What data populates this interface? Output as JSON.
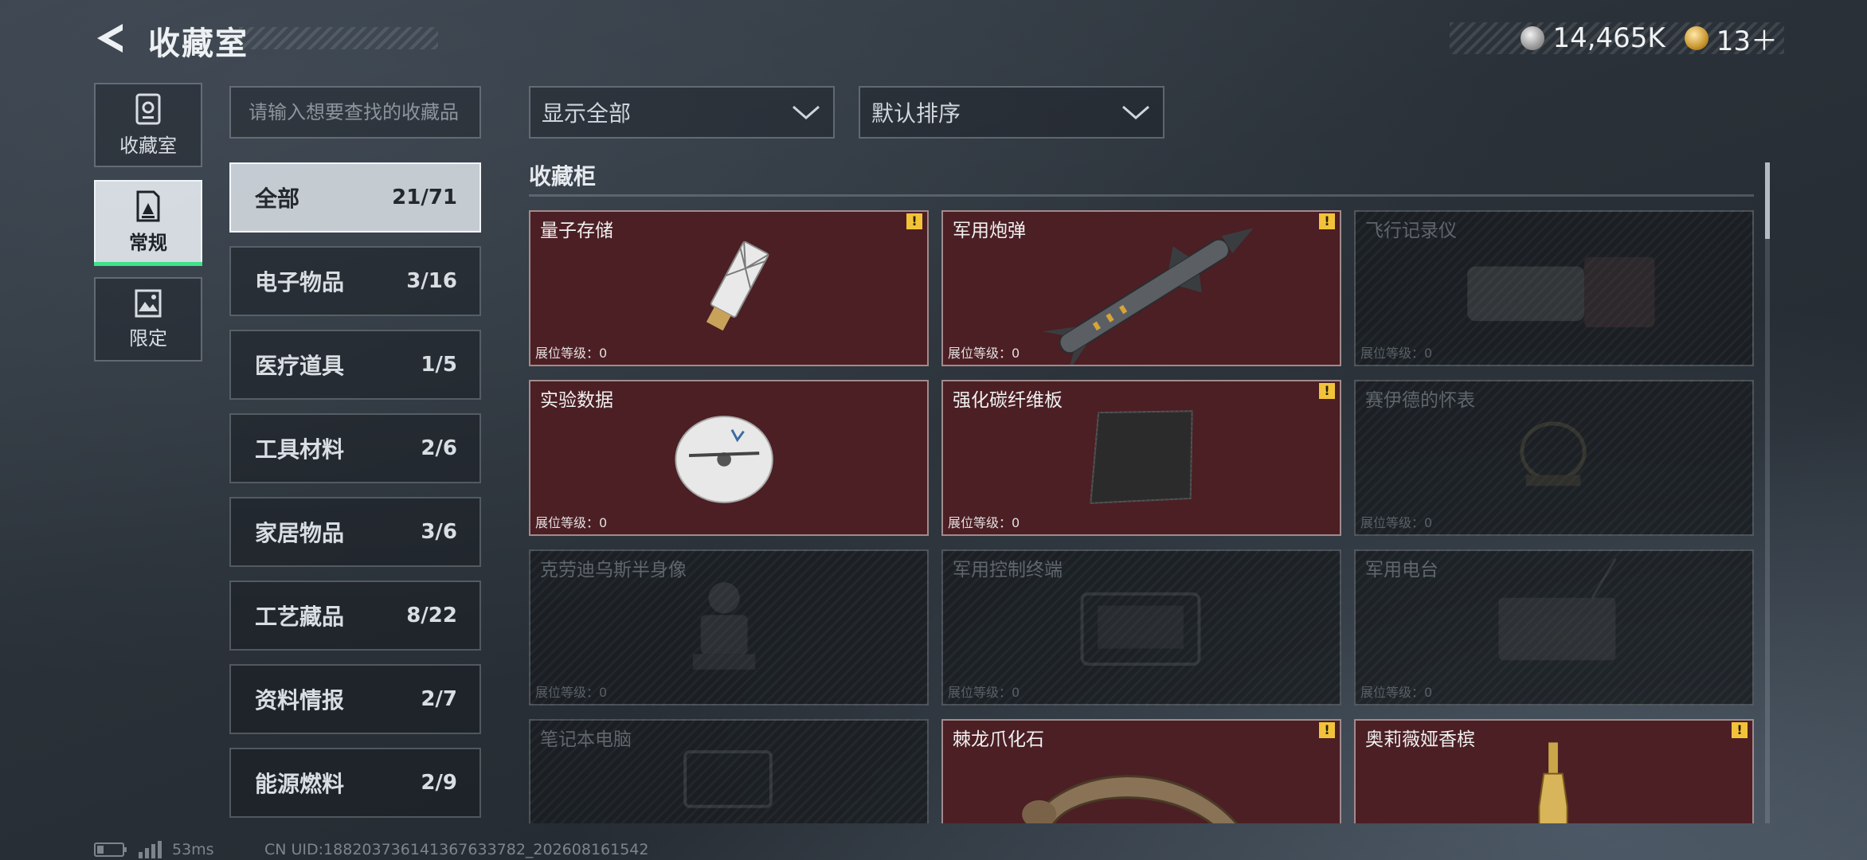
{
  "header": {
    "title": "收藏室",
    "currency": [
      {
        "icon": "silver-coin-icon",
        "value": "14,465K"
      },
      {
        "icon": "gold-coin-icon",
        "value": "13＋"
      }
    ]
  },
  "sidenav": [
    {
      "label": "收藏室",
      "icon": "vault-icon",
      "active": false
    },
    {
      "label": "常规",
      "icon": "collection-icon",
      "active": true
    },
    {
      "label": "限定",
      "icon": "landscape-icon",
      "active": false
    }
  ],
  "search": {
    "placeholder": "请输入想要查找的收藏品",
    "value": ""
  },
  "categories": [
    {
      "name": "全部",
      "count": "21/71",
      "active": true
    },
    {
      "name": "电子物品",
      "count": "3/16",
      "active": false
    },
    {
      "name": "医疗道具",
      "count": "1/5",
      "active": false
    },
    {
      "name": "工具材料",
      "count": "2/6",
      "active": false
    },
    {
      "name": "家居物品",
      "count": "3/6",
      "active": false
    },
    {
      "name": "工艺藏品",
      "count": "8/22",
      "active": false
    },
    {
      "name": "资料情报",
      "count": "2/7",
      "active": false
    },
    {
      "name": "能源燃料",
      "count": "2/9",
      "active": false
    }
  ],
  "filters": {
    "show": "显示全部",
    "sort": "默认排序"
  },
  "section": {
    "title": "收藏柜"
  },
  "items": [
    {
      "name": "量子存储",
      "level": "展位等级：0",
      "unlocked": true,
      "alert": true,
      "art": "usb"
    },
    {
      "name": "军用炮弹",
      "level": "展位等级：0",
      "unlocked": true,
      "alert": true,
      "art": "missile"
    },
    {
      "name": "飞行记录仪",
      "level": "展位等级：0",
      "unlocked": false,
      "alert": false,
      "art": "recorder"
    },
    {
      "name": "实验数据",
      "level": "展位等级：0",
      "unlocked": true,
      "alert": false,
      "art": "disc"
    },
    {
      "name": "强化碳纤维板",
      "level": "展位等级：0",
      "unlocked": true,
      "alert": true,
      "art": "plate"
    },
    {
      "name": "赛伊德的怀表",
      "level": "展位等级：0",
      "unlocked": false,
      "alert": false,
      "art": "watch"
    },
    {
      "name": "克劳迪乌斯半身像",
      "level": "展位等级：0",
      "unlocked": false,
      "alert": false,
      "art": "bust"
    },
    {
      "name": "军用控制终端",
      "level": "展位等级：0",
      "unlocked": false,
      "alert": false,
      "art": "terminal"
    },
    {
      "name": "军用电台",
      "level": "展位等级：0",
      "unlocked": false,
      "alert": false,
      "art": "radio"
    },
    {
      "name": "笔记本电脑",
      "level": "",
      "unlocked": false,
      "alert": false,
      "art": "laptop"
    },
    {
      "name": "棘龙爪化石",
      "level": "",
      "unlocked": true,
      "alert": true,
      "art": "claw"
    },
    {
      "name": "奥莉薇娅香槟",
      "level": "",
      "unlocked": true,
      "alert": true,
      "art": "bottle"
    }
  ],
  "alert_glyph": "!",
  "footer": {
    "ping": "53ms",
    "uid": "CN UID:188203736141367633782_202608161542"
  },
  "colors": {
    "accent": "#3fe28b",
    "card_unlocked": "#4b1f24",
    "alert": "#f2c33a"
  }
}
